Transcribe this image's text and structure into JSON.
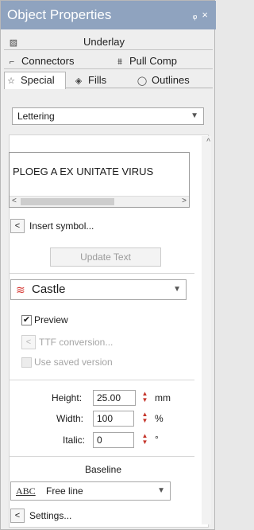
{
  "window": {
    "title": "Object Properties",
    "pin_icon": "pin-icon",
    "close_icon": "close-icon"
  },
  "tabs": {
    "row1": [
      {
        "label": "Underlay",
        "icon": "underlay-icon"
      }
    ],
    "row2": [
      {
        "label": "Connectors",
        "icon": "connectors-icon"
      },
      {
        "label": "Pull Comp",
        "icon": "pull-comp-icon"
      }
    ],
    "row3": [
      {
        "label": "Special",
        "icon": "star-icon",
        "active": true
      },
      {
        "label": "Fills",
        "icon": "fills-icon"
      },
      {
        "label": "Outlines",
        "icon": "outlines-icon"
      }
    ]
  },
  "type_select": {
    "value": "Lettering"
  },
  "text_box": {
    "value": "PLOEG A EX UNITATE VIRUS"
  },
  "insert_symbol_label": "Insert symbol...",
  "update_text_label": "Update Text",
  "font_select": {
    "value": "Castle"
  },
  "preview": {
    "label": "Preview",
    "checked": true
  },
  "ttf_conversion_label": "TTF conversion...",
  "use_saved_version": {
    "label": "Use saved version",
    "checked": false
  },
  "height": {
    "label": "Height:",
    "value": "25.00",
    "unit": "mm"
  },
  "width": {
    "label": "Width:",
    "value": "100",
    "unit": "%"
  },
  "italic": {
    "label": "Italic:",
    "value": "0",
    "unit": "°"
  },
  "baseline": {
    "heading": "Baseline",
    "icon_text": "ABC",
    "value": "Free line"
  },
  "settings_label": "Settings..."
}
